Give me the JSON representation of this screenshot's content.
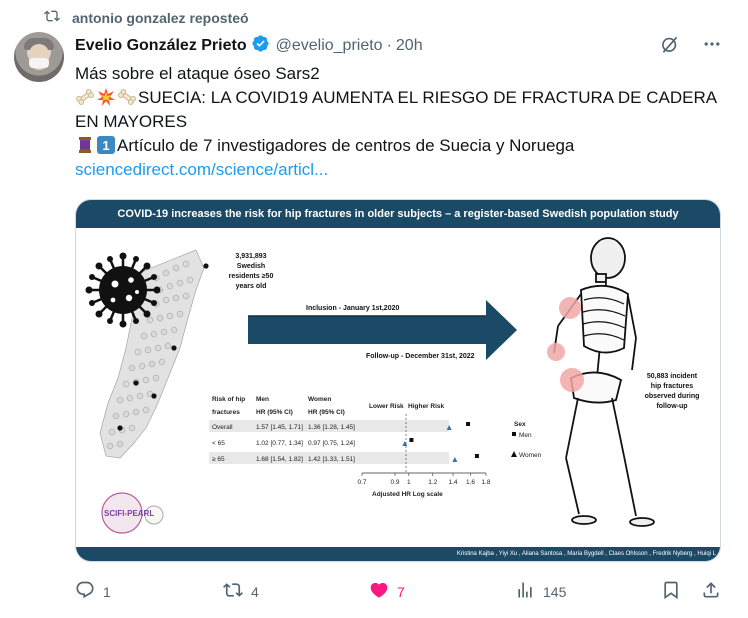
{
  "repost": {
    "text": "antonio gonzalez reposteó",
    "icon": "repost-icon"
  },
  "author": {
    "name": "Evelio González Prieto",
    "handle": "@evelio_prieto",
    "separator": "·",
    "time": "20h",
    "verified": true
  },
  "tweet": {
    "line1": "Más sobre el ataque óseo Sars2",
    "line2": "SUECIA: LA COVID19 AUMENTA EL RIESGO DE FRACTURA DE CADERA EN MAYORES",
    "line3": "Artículo de 7 investigadores de centros de Suecia y Noruega",
    "link": "sciencedirect.com/science/articl..."
  },
  "card": {
    "title": "COVID-19 increases the risk for hip fractures in older subjects – a register-based Swedish population study",
    "population_number": "3,931,893",
    "population_line2": "Swedish",
    "population_line3": "residents ≥50",
    "population_line4": "years old",
    "inclusion": "Inclusion - January 1st,2020",
    "followup": "Follow-up - December 31st, 2022",
    "fractures_number": "50,883 incident",
    "fractures_line2": "hip fractures",
    "fractures_line3": "observed during",
    "fractures_line4": "follow-up",
    "table": {
      "header_risk_1": "Risk of hip",
      "header_risk_2": "fractures",
      "header_men_1": "Men",
      "header_men_2": "HR (95% CI)",
      "header_women_1": "Women",
      "header_women_2": "HR (95% CI)",
      "rows": [
        {
          "label": "Overall",
          "men": "1.57 [1.45, 1.71]",
          "women": "1.36 [1.28, 1.45]",
          "men_hr": 1.57,
          "women_hr": 1.36
        },
        {
          "label": "< 65",
          "men": "1.02 [0.77, 1.34]",
          "women": "0.97 [0.75, 1.24]",
          "men_hr": 1.02,
          "women_hr": 0.97
        },
        {
          "label": "≥ 65",
          "men": "1.68 [1.54, 1.82]",
          "women": "1.42 [1.33, 1.51]",
          "men_hr": 1.68,
          "women_hr": 1.42
        }
      ]
    },
    "plot": {
      "lower_risk": "Lower Risk",
      "higher_risk": "Higher Risk",
      "ticks": [
        "0.7",
        "0.9",
        "1",
        "1.2",
        "1.4",
        "1.6",
        "1.8"
      ],
      "xlabel": "Adjusted HR Log scale",
      "legend_title": "Sex",
      "legend_men": "Men",
      "legend_women": "Women"
    },
    "logo_text": "SCIFI-PEARL",
    "authors": "Kristina Kajba , Yiyi Xu , Aliana Santosa , Maria Bygdell , Claes Ohlsson , Fredrik Nyberg , Huiqi L"
  },
  "actions": {
    "replies": "1",
    "reposts": "4",
    "likes": "7",
    "views": "145"
  },
  "colors": {
    "accent": "#1d9bf0",
    "like": "#f91880",
    "muted": "#536471",
    "card_header": "#1b4a66"
  }
}
